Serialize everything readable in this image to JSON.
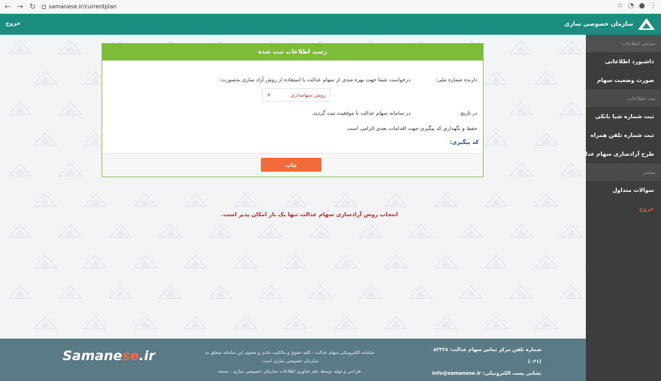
{
  "browser": {
    "url": "samanese.ir/currentplan"
  },
  "topbar": {
    "logout": "خروج",
    "brand": "سازمان خصوصی سازی"
  },
  "sidebar": {
    "items": [
      {
        "label": "نمایش اطلاعات",
        "type": "head"
      },
      {
        "label": "داشبورد اطلاعاتی",
        "type": "item"
      },
      {
        "label": "صورت وضعیت سهام",
        "type": "item"
      },
      {
        "label": "ثبت اطلاعات",
        "type": "head"
      },
      {
        "label": "ثبت شماره شبا بانکی",
        "type": "item"
      },
      {
        "label": "ثبت شماره تلفن همراه",
        "type": "item"
      },
      {
        "label": "طرح آزادسازی سهام عدالت",
        "type": "item"
      },
      {
        "label": "بیشتر",
        "type": "head"
      },
      {
        "label": "سوالات متداول",
        "type": "item"
      },
      {
        "label": "خروج",
        "type": "exit"
      }
    ]
  },
  "receipt": {
    "title": "رسید اطلاعات ثبت شده",
    "holder_label": "دارنده شماره ملی:",
    "request_text": "درخواست شما جهت بهره مندی از سهام عدالت با استفاده از روش آزاد سازی به‌صورت:",
    "method_value": "روش سهامداری",
    "remove_symbol": "×",
    "date_label": "در تاریخ",
    "registered_text": "در سامانه سهام عدالت با موفقیت ثبت گردید.",
    "keep_code_text": "حفظ و نگهداری کد پیگیری جهت اقدامات بعدی الزامی است.",
    "tracking_label": "کد پیگیری:",
    "print_label": "چاپ"
  },
  "warning": "انتخاب روش آزادسازی سهام عدالت تنها یک بار امکان پذیر است.",
  "footer": {
    "logo_main": "Samane",
    "logo_accent": "se",
    "logo_tail": ".ir",
    "rights_text": "سامانه الکترونیکی سهام عدالت - کلیه حقوق و مالکیت مادی و معنوی این سامانه متعلق به سازمان خصوصی سازی است.",
    "design_text": "طراحی و تولید توسط دفتر فناوری اطلاعات سازمان خصوصی سازی - نسخه",
    "phone_text": "شماره تلفن مرکز تماس سهام عدالت: ۸۳۳۳۸ (۰۲۱)",
    "email_text": "نشانی پست الکترونیکی: info@samanese.ir"
  },
  "colors": {
    "topbar": "#1b8c80",
    "sidebar": "#3d3d3d",
    "card_header": "#7dbb3c",
    "print_button": "#f26b3a",
    "warning": "#c62828",
    "footer": "#5a7a85"
  }
}
